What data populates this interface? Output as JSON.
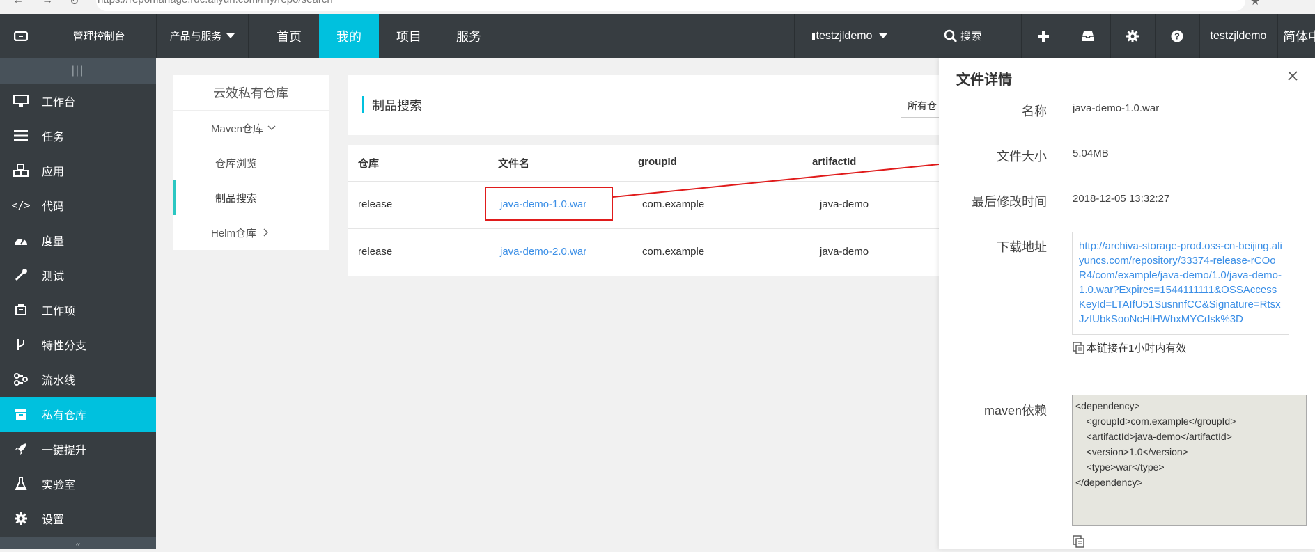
{
  "browser": {
    "url": "https://repomanage.rdc.aliyun.com/my/repo/search"
  },
  "topnav": {
    "console": "管理控制台",
    "products": "产品与服务",
    "items": [
      "首页",
      "我的",
      "项目",
      "服务"
    ],
    "active_item": "我的",
    "org": "testzjldemo",
    "search": "搜索",
    "username": "testzjldemo",
    "language": "简体中文"
  },
  "sidebar": {
    "toggle": "|||",
    "items": [
      "工作台",
      "任务",
      "应用",
      "代码",
      "度量",
      "测试",
      "工作项",
      "特性分支",
      "流水线",
      "私有仓库",
      "一键提升",
      "实验室",
      "设置"
    ],
    "active": "私有仓库",
    "collapse": "«"
  },
  "leftpanel": {
    "title": "云效私有仓库",
    "maven": "Maven仓库",
    "browse": "仓库浏览",
    "search": "制品搜索",
    "helm": "Helm仓库"
  },
  "search_card": {
    "title": "制品搜索",
    "repo_select": "所有仓"
  },
  "table": {
    "headers": [
      "仓库",
      "文件名",
      "groupId",
      "artifactId"
    ],
    "rows": [
      {
        "repo": "release",
        "file": "java-demo-1.0.war",
        "group": "com.example",
        "artifact": "java-demo"
      },
      {
        "repo": "release",
        "file": "java-demo-2.0.war",
        "group": "com.example",
        "artifact": "java-demo"
      }
    ]
  },
  "drawer": {
    "title": "文件详情",
    "name_label": "名称",
    "name": "java-demo-1.0.war",
    "size_label": "文件大小",
    "size": "5.04MB",
    "modified_label": "最后修改时间",
    "modified": "2018-12-05 13:32:27",
    "download_label": "下载地址",
    "download_url": "http://archiva-storage-prod.oss-cn-beijing.aliyuncs.com/repository/33374-release-rCOoR4/com/example/java-demo/1.0/java-demo-1.0.war?Expires=1544111111&OSSAccessKeyId=LTAIfU51SusnnfCC&Signature=RtsxJzfUbkSooNcHtHWhxMYCdsk%3D",
    "link_note": "本链接在1小时内有效",
    "maven_label": "maven依赖",
    "maven_dependency": "<dependency>\n    <groupId>com.example</groupId>\n    <artifactId>java-demo</artifactId>\n    <version>1.0</version>\n    <type>war</type>\n</dependency>"
  },
  "colors": {
    "accent": "#00c1de",
    "nav_bg": "#373d41",
    "link": "#3a8ee6",
    "annotation": "#e01b1b"
  }
}
